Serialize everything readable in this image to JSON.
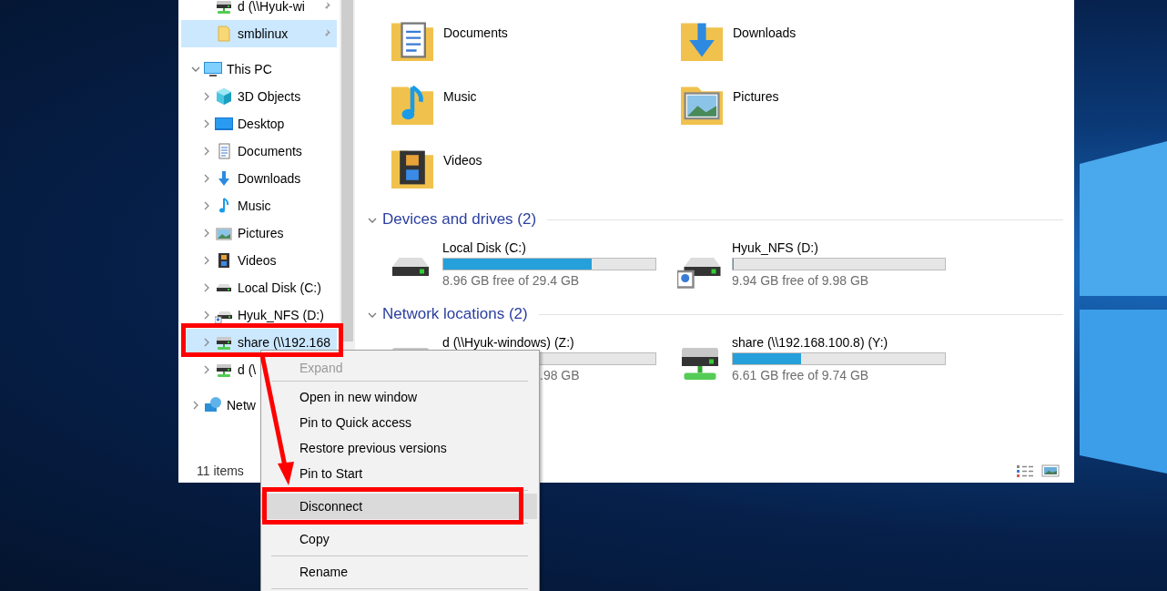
{
  "sidebar": {
    "quick_access_items": [
      {
        "label": "d (\\\\Hyuk-wi",
        "kind": "network-drive",
        "pinned": true,
        "selected": false
      },
      {
        "label": "smblinux",
        "kind": "folder",
        "pinned": true,
        "selected": true
      }
    ],
    "tree": [
      {
        "label": "This PC",
        "kind": "pc",
        "expanded": true,
        "selected": false,
        "children": [
          {
            "label": "3D Objects",
            "kind": "cube",
            "expanded": false,
            "selected": false
          },
          {
            "label": "Desktop",
            "kind": "desktop",
            "expanded": false,
            "selected": false
          },
          {
            "label": "Documents",
            "kind": "document",
            "expanded": false,
            "selected": false
          },
          {
            "label": "Downloads",
            "kind": "download",
            "expanded": false,
            "selected": false
          },
          {
            "label": "Music",
            "kind": "music",
            "expanded": false,
            "selected": false
          },
          {
            "label": "Pictures",
            "kind": "pictures",
            "expanded": false,
            "selected": false
          },
          {
            "label": "Videos",
            "kind": "videos",
            "expanded": false,
            "selected": false
          },
          {
            "label": "Local Disk (C:)",
            "kind": "disk",
            "expanded": false,
            "selected": false
          },
          {
            "label": "Hyuk_NFS (D:)",
            "kind": "shared-disk",
            "expanded": false,
            "selected": false
          },
          {
            "label": "share (\\\\192.168",
            "kind": "network-drive",
            "expanded": false,
            "selected": true
          },
          {
            "label": "d (\\",
            "kind": "network-drive",
            "expanded": false,
            "selected": false
          }
        ]
      },
      {
        "label": "Netw",
        "kind": "network",
        "expanded": false,
        "selected": false
      }
    ]
  },
  "content": {
    "folders": [
      {
        "label": "Documents",
        "kind": "document"
      },
      {
        "label": "Downloads",
        "kind": "download"
      },
      {
        "label": "Music",
        "kind": "music"
      },
      {
        "label": "Pictures",
        "kind": "pictures"
      },
      {
        "label": "Videos",
        "kind": "videos"
      }
    ],
    "sections": [
      {
        "title": "Devices and drives (2)",
        "expanded": true,
        "drives": [
          {
            "name": "Local Disk (C:)",
            "kind": "disk",
            "level": 0.7,
            "free_text": "8.96 GB free of 29.4 GB"
          },
          {
            "name": "Hyuk_NFS (D:)",
            "kind": "shared-disk",
            "level": 0.004,
            "free_text": "9.94 GB free of 9.98 GB"
          }
        ]
      },
      {
        "title": "Network locations (2)",
        "expanded": true,
        "drives": [
          {
            "name": "d (\\\\Hyuk-windows) (Z:)",
            "kind": "network-drive",
            "free_text": ".98 GB"
          },
          {
            "name": "share (\\\\192.168.100.8) (Y:)",
            "kind": "network-drive",
            "level": 0.32,
            "free_text": "6.61 GB free of 9.74 GB"
          }
        ]
      }
    ]
  },
  "status_bar": {
    "item_count": "11 items"
  },
  "context_menu": {
    "items": [
      {
        "kind": "item",
        "label": "Expand",
        "disabled": true,
        "selected": false
      },
      {
        "kind": "separator"
      },
      {
        "kind": "item",
        "label": "Open in new window",
        "disabled": false,
        "selected": false
      },
      {
        "kind": "item",
        "label": "Pin to Quick access",
        "disabled": false,
        "selected": false
      },
      {
        "kind": "item",
        "label": "Restore previous versions",
        "disabled": false,
        "selected": false
      },
      {
        "kind": "item",
        "label": "Pin to Start",
        "disabled": false,
        "selected": false
      },
      {
        "kind": "separator"
      },
      {
        "kind": "item",
        "label": "Disconnect",
        "disabled": false,
        "selected": true
      },
      {
        "kind": "separator"
      },
      {
        "kind": "item",
        "label": "Copy",
        "disabled": false,
        "selected": false
      },
      {
        "kind": "separator"
      },
      {
        "kind": "item",
        "label": "Rename",
        "disabled": false,
        "selected": false
      },
      {
        "kind": "separator"
      }
    ]
  }
}
